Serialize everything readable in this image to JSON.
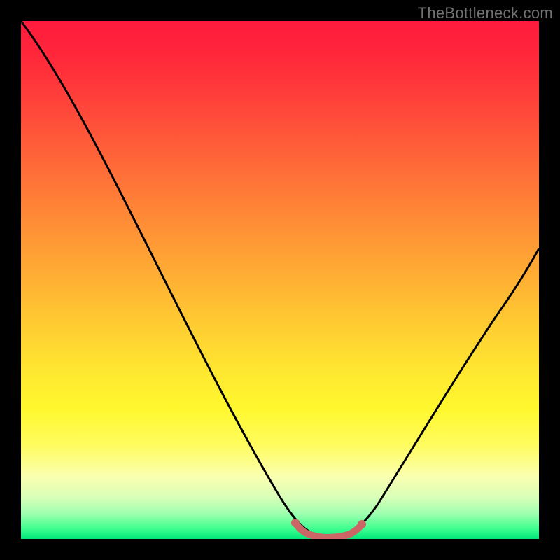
{
  "watermark": "TheBottleneck.com",
  "chart_data": {
    "type": "line",
    "title": "",
    "xlabel": "",
    "ylabel": "",
    "xlim": [
      0,
      100
    ],
    "ylim": [
      0,
      100
    ],
    "grid": false,
    "background_gradient": {
      "top_color": "#ff1a3c",
      "bottom_color": "#00e878",
      "note": "vertical rainbow gradient red→orange→yellow→green representing bottleneck severity (red high, green low)"
    },
    "series": [
      {
        "name": "bottleneck-curve",
        "color": "#000000",
        "x": [
          0,
          5,
          10,
          15,
          20,
          25,
          30,
          35,
          40,
          45,
          50,
          53,
          56,
          60,
          63,
          65,
          70,
          75,
          80,
          85,
          90,
          95,
          100
        ],
        "values": [
          100,
          94,
          87,
          79,
          70,
          60,
          50,
          40,
          30,
          20,
          11,
          5,
          1,
          0,
          1,
          3,
          9,
          17,
          26,
          36,
          45,
          53,
          60
        ]
      },
      {
        "name": "optimal-zone-marker",
        "color": "#cc6666",
        "x": [
          53,
          55,
          57,
          59,
          61,
          63,
          65
        ],
        "values": [
          3,
          1,
          0,
          0,
          0,
          1,
          3
        ],
        "note": "thick salmon-colored highlight along the valley floor indicating the balanced/no-bottleneck region"
      }
    ]
  }
}
